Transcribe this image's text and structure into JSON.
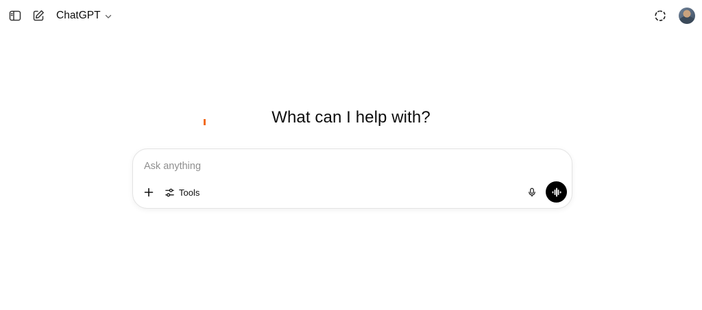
{
  "header": {
    "model_name": "ChatGPT",
    "icons": {
      "sidebar_toggle": "sidebar-toggle-icon",
      "new_chat": "new-chat-icon",
      "model_chevron": "chevron-down-icon",
      "temporary_chat": "temporary-chat-icon",
      "avatar": "user-avatar"
    }
  },
  "main": {
    "headline": "What can I help with?"
  },
  "composer": {
    "placeholder": "Ask anything",
    "value": "",
    "tools_label": "Tools",
    "icons": {
      "add": "plus-icon",
      "tools": "sliders-icon",
      "mic": "microphone-icon",
      "voice": "voice-mode-icon"
    }
  },
  "colors": {
    "accent_cursor": "#f26b1d",
    "voice_button_bg": "#000000",
    "text": "#0d0d0d",
    "placeholder": "#8f8f8f"
  }
}
